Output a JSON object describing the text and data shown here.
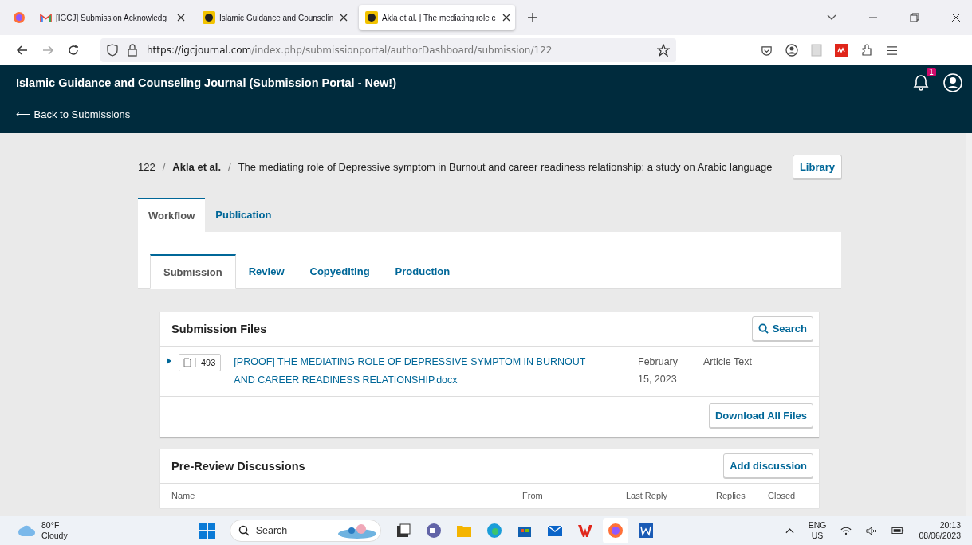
{
  "browser": {
    "tabs": [
      {
        "title": "[IGCJ] Submission Acknowledg",
        "kind": "mail",
        "selected": false
      },
      {
        "title": "Islamic Guidance and Counselin",
        "kind": "journal",
        "selected": false
      },
      {
        "title": "Akla et al. | The mediating role c",
        "kind": "journal",
        "selected": true
      }
    ],
    "url_host": "https://igcjournal.com",
    "url_path": "/index.php/submissionportal/authorDashboard/submission/122"
  },
  "header": {
    "title": "Islamic Guidance and Counseling Journal (Submission Portal - New!)",
    "back_link": "⟵ Back to Submissions",
    "notification_count": "1"
  },
  "breadcrumb": {
    "id": "122",
    "separators": [
      "/",
      "/"
    ],
    "authors": "Akla et al.",
    "title": "The mediating role of Depressive symptom in Burnout and career readiness relationship: a study on Arabic language"
  },
  "library_button": "Library",
  "main_tabs": [
    {
      "label": "Workflow",
      "selected": true
    },
    {
      "label": "Publication",
      "selected": false
    }
  ],
  "stage_tabs": [
    {
      "label": "Submission",
      "selected": true
    },
    {
      "label": "Review",
      "selected": false
    },
    {
      "label": "Copyediting",
      "selected": false
    },
    {
      "label": "Production",
      "selected": false
    }
  ],
  "submission_files": {
    "heading": "Submission Files",
    "search_button": "Search",
    "files": [
      {
        "id": "493",
        "name": "[PROOF] THE MEDIATING ROLE OF DEPRESSIVE SYMPTOM IN BURNOUT AND CAREER READINESS RELATIONSHIP.docx",
        "date": "February 15, 2023",
        "type": "Article Text",
        "expanded": false
      }
    ],
    "download_button": "Download All Files"
  },
  "discussions": {
    "heading": "Pre-Review Discussions",
    "add_button": "Add discussion",
    "columns": [
      "Name",
      "From",
      "Last Reply",
      "Replies",
      "Closed"
    ]
  },
  "taskbar": {
    "temperature": "80°F",
    "condition": "Cloudy",
    "search_placeholder": "Search",
    "language": "ENG",
    "region": "US",
    "time": "20:13",
    "date": "08/06/2023"
  }
}
